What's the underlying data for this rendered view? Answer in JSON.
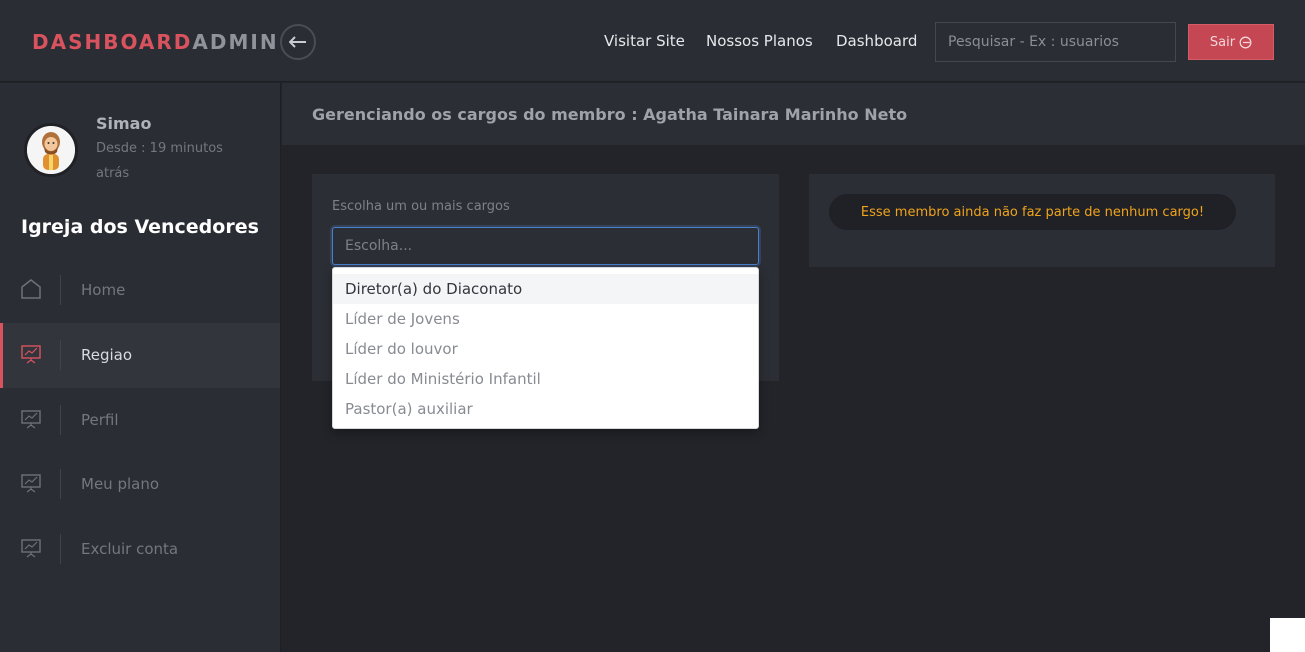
{
  "header": {
    "brand_part1": "DASHBOARD",
    "brand_part2": "ADMIN",
    "nav": [
      "Visitar Site",
      "Nossos Planos",
      "Dashboard"
    ],
    "search_placeholder": "Pesquisar - Ex : usuarios",
    "logout_label": "Sair"
  },
  "sidebar": {
    "user_name": "Simao",
    "user_since": "Desde : 19 minutos atrás",
    "church_name": "Igreja dos Vencedores",
    "items": [
      {
        "label": "Home",
        "icon": "home-icon"
      },
      {
        "label": "Regiao",
        "icon": "presentation-chart-icon"
      },
      {
        "label": "Perfil",
        "icon": "presentation-chart-icon"
      },
      {
        "label": "Meu plano",
        "icon": "presentation-chart-icon"
      },
      {
        "label": "Excluir conta",
        "icon": "presentation-chart-icon"
      }
    ],
    "active_index": 1
  },
  "main": {
    "title": "Gerenciando os cargos do membro : Agatha Tainara Marinho Neto",
    "select_label": "Escolha um ou mais cargos",
    "select_placeholder": "Escolha...",
    "options": [
      "Diretor(a) do Diaconato",
      "Líder de Jovens",
      "Líder do louvor",
      "Líder do Ministério Infantil",
      "Pastor(a) auxiliar"
    ],
    "highlighted_option": 0,
    "notice": "Esse membro ainda não faz parte de nenhum cargo!"
  },
  "colors": {
    "accent": "#d9535f",
    "logout_bg": "#c44753",
    "notice_text": "#f0a41c",
    "focus_border": "#4a7fc9"
  }
}
